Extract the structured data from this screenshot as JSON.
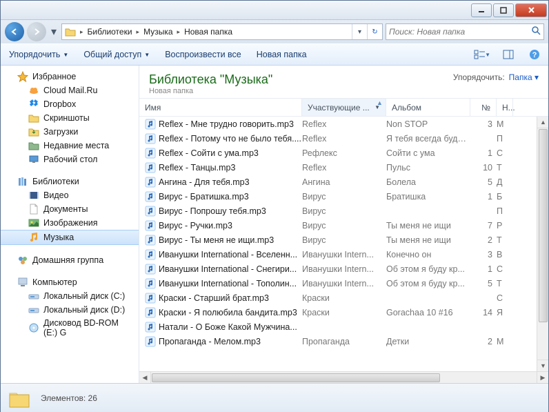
{
  "breadcrumb": [
    "Библиотеки",
    "Музыка",
    "Новая папка"
  ],
  "search": {
    "placeholder": "Поиск: Новая папка"
  },
  "toolbar": {
    "organize": "Упорядочить",
    "share": "Общий доступ",
    "play_all": "Воспроизвести все",
    "new_folder": "Новая папка"
  },
  "library": {
    "title": "Библиотека \"Музыка\"",
    "subtitle": "Новая папка",
    "arrange_label": "Упорядочить:",
    "arrange_value": "Папка"
  },
  "sidebar": {
    "favorites": {
      "label": "Избранное",
      "items": [
        "Cloud Mail.Ru",
        "Dropbox",
        "Скриншоты",
        "Загрузки",
        "Недавние места",
        "Рабочий стол"
      ]
    },
    "libraries": {
      "label": "Библиотеки",
      "items": [
        "Видео",
        "Документы",
        "Изображения",
        "Музыка"
      ]
    },
    "homegroup": {
      "label": "Домашняя группа"
    },
    "computer": {
      "label": "Компьютер",
      "items": [
        "Локальный диск (C:)",
        "Локальный диск (D:)",
        "Дисковод BD-ROM (E:) G"
      ]
    }
  },
  "columns": {
    "name": "Имя",
    "artist": "Участвующие ...",
    "album": "Альбом",
    "num": "№",
    "n2": "Н..."
  },
  "files": [
    {
      "name": "Reflex - Мне трудно говорить.mp3",
      "artist": "Reflex",
      "album": "Non STOP",
      "num": "3",
      "n2": "М"
    },
    {
      "name": "Reflex - Потому что не было тебя....",
      "artist": "Reflex",
      "album": "Я тебя всегда буду ...",
      "num": "",
      "n2": "П"
    },
    {
      "name": "Reflex - Сойти с ума.mp3",
      "artist": "Рефлекс",
      "album": "Сойти с ума",
      "num": "1",
      "n2": "С"
    },
    {
      "name": "Reflex - Танцы.mp3",
      "artist": "Reflex",
      "album": "Пульс",
      "num": "10",
      "n2": "Т"
    },
    {
      "name": "Ангина - Для тебя.mp3",
      "artist": "Ангина",
      "album": "Болела",
      "num": "5",
      "n2": "Д"
    },
    {
      "name": "Вирус - Братишка.mp3",
      "artist": "Вирус",
      "album": "Братишка",
      "num": "1",
      "n2": "Б"
    },
    {
      "name": "Вирус - Попрошу тебя.mp3",
      "artist": "Вирус",
      "album": "",
      "num": "",
      "n2": "П"
    },
    {
      "name": "Вирус - Ручки.mp3",
      "artist": "Вирус",
      "album": "Ты меня не ищи",
      "num": "7",
      "n2": "Р"
    },
    {
      "name": "Вирус - Ты меня не ищи.mp3",
      "artist": "Вирус",
      "album": "Ты меня не ищи",
      "num": "2",
      "n2": "Т"
    },
    {
      "name": "Иванушки International - Вселенн...",
      "artist": "Иванушки Intern...",
      "album": "Конечно он",
      "num": "3",
      "n2": "В"
    },
    {
      "name": "Иванушки International - Снегири...",
      "artist": "Иванушки Intern...",
      "album": "Об этом я буду кр...",
      "num": "1",
      "n2": "С"
    },
    {
      "name": "Иванушки International - Тополин...",
      "artist": "Иванушки Intern...",
      "album": "Об этом я буду кр...",
      "num": "5",
      "n2": "Т"
    },
    {
      "name": "Краски - Старший брат.mp3",
      "artist": "Краски",
      "album": "",
      "num": "",
      "n2": "С"
    },
    {
      "name": "Краски - Я полюбила бандита.mp3",
      "artist": "Краски",
      "album": "Gorachaa 10 #16",
      "num": "14",
      "n2": "Я"
    },
    {
      "name": "Натали - О Боже Какой Мужчина...",
      "artist": "",
      "album": "",
      "num": "",
      "n2": ""
    },
    {
      "name": "Пропаганда - Мелом.mp3",
      "artist": "Пропаганда",
      "album": "Детки",
      "num": "2",
      "n2": "М"
    }
  ],
  "status": {
    "count_label": "Элементов: 26"
  }
}
